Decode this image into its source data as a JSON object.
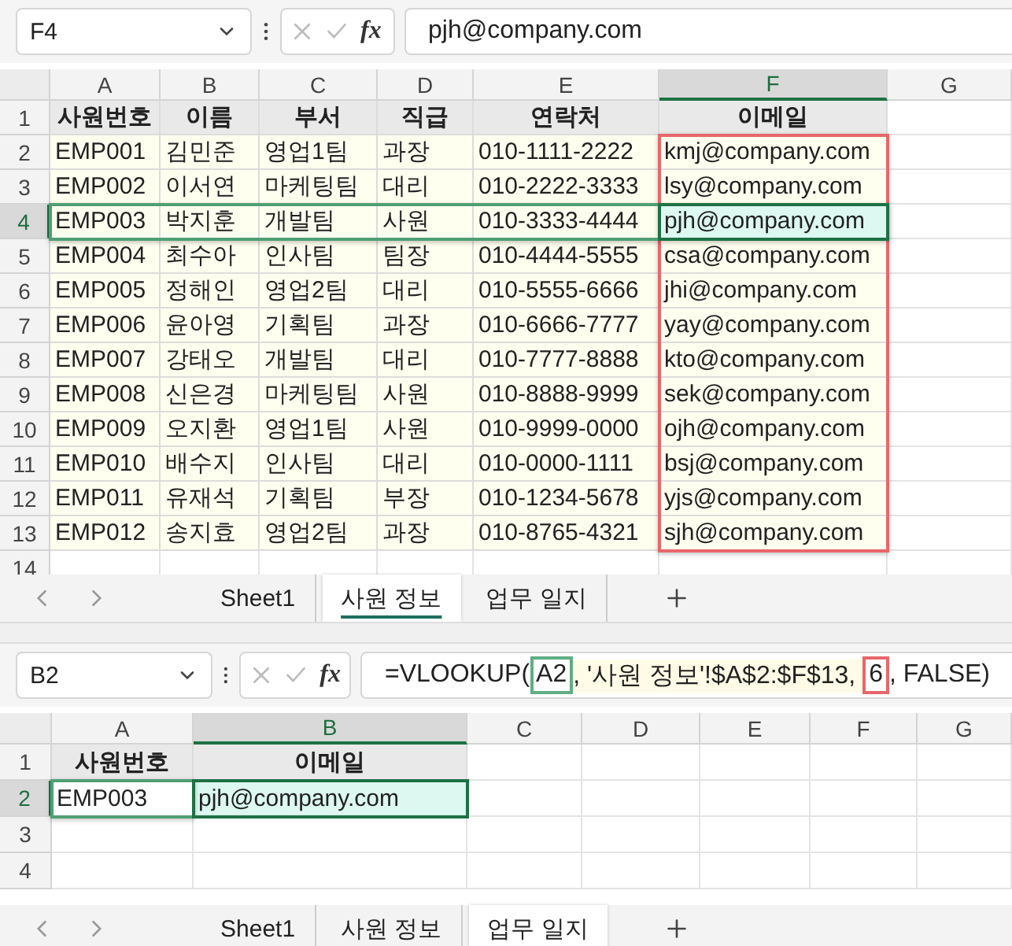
{
  "sheets": [
    {
      "formula_bar": {
        "name_box": "F4",
        "function_label": "fx",
        "parts": [
          {
            "text": "pjh@company.com",
            "kind": "plain"
          }
        ]
      },
      "columns": [
        {
          "label": "A",
          "selected": false
        },
        {
          "label": "B",
          "selected": false
        },
        {
          "label": "C",
          "selected": false
        },
        {
          "label": "D",
          "selected": false
        },
        {
          "label": "E",
          "selected": false
        },
        {
          "label": "F",
          "selected": true,
          "result_outline": true
        },
        {
          "label": "G",
          "selected": false
        }
      ],
      "rows": [
        {
          "number": "1",
          "selected": false,
          "kind": "header",
          "cells": [
            "사원번호",
            "이름",
            "부서",
            "직급",
            "연락처",
            "이메일"
          ]
        },
        {
          "number": "2",
          "selected": false,
          "kind": "data",
          "cells": [
            "EMP001",
            "김민준",
            "영업1팀",
            "과장",
            "010-1111-2222",
            "kmj@company.com"
          ]
        },
        {
          "number": "3",
          "selected": false,
          "kind": "data",
          "cells": [
            "EMP002",
            "이서연",
            "마케팅팀",
            "대리",
            "010-2222-3333",
            "lsy@company.com"
          ]
        },
        {
          "number": "4",
          "selected": true,
          "ref_outline": true,
          "kind": "data",
          "cells": [
            "EMP003",
            "박지훈",
            "개발팀",
            "사원",
            "010-3333-4444",
            "pjh@company.com"
          ]
        },
        {
          "number": "5",
          "selected": false,
          "kind": "data",
          "cells": [
            "EMP004",
            "최수아",
            "인사팀",
            "팀장",
            "010-4444-5555",
            "csa@company.com"
          ]
        },
        {
          "number": "6",
          "selected": false,
          "kind": "data",
          "cells": [
            "EMP005",
            "정해인",
            "영업2팀",
            "대리",
            "010-5555-6666",
            "jhi@company.com"
          ]
        },
        {
          "number": "7",
          "selected": false,
          "kind": "data",
          "cells": [
            "EMP006",
            "윤아영",
            "기획팀",
            "과장",
            "010-6666-7777",
            "yay@company.com"
          ]
        },
        {
          "number": "8",
          "selected": false,
          "kind": "data",
          "cells": [
            "EMP007",
            "강태오",
            "개발팀",
            "대리",
            "010-7777-8888",
            "kto@company.com"
          ]
        },
        {
          "number": "9",
          "selected": false,
          "kind": "data",
          "cells": [
            "EMP008",
            "신은경",
            "마케팅팀",
            "사원",
            "010-8888-9999",
            "sek@company.com"
          ]
        },
        {
          "number": "10",
          "selected": false,
          "kind": "data",
          "cells": [
            "EMP009",
            "오지환",
            "영업1팀",
            "사원",
            "010-9999-0000",
            "ojh@company.com"
          ]
        },
        {
          "number": "11",
          "selected": false,
          "kind": "data",
          "cells": [
            "EMP010",
            "배수지",
            "인사팀",
            "대리",
            "010-0000-1111",
            "bsj@company.com"
          ]
        },
        {
          "number": "12",
          "selected": false,
          "kind": "data",
          "cells": [
            "EMP011",
            "유재석",
            "기획팀",
            "부장",
            "010-1234-5678",
            "yjs@company.com"
          ]
        },
        {
          "number": "13",
          "selected": false,
          "kind": "data",
          "cells": [
            "EMP012",
            "송지효",
            "영업2팀",
            "과장",
            "010-8765-4321",
            "sjh@company.com"
          ]
        },
        {
          "number": "14",
          "selected": false,
          "cells": []
        }
      ],
      "tabs": [
        {
          "label": "Sheet1",
          "selected": false
        },
        {
          "label": "사원 정보",
          "selected": true
        },
        {
          "label": "업무 일지",
          "selected": false
        }
      ]
    },
    {
      "formula_bar": {
        "name_box": "B2",
        "function_label": "fx",
        "parts": [
          {
            "text": "=VLOOKUP(",
            "kind": "plain"
          },
          {
            "text": "A2",
            "kind": "reference"
          },
          {
            "text": ", '사원 정보'!$A$2:$F$13, ",
            "kind": "hint"
          },
          {
            "text": "6",
            "kind": "result"
          },
          {
            "text": ", FALSE)",
            "kind": "plain"
          }
        ]
      },
      "columns": [
        {
          "label": "A",
          "selected": false,
          "ref_outline": true
        },
        {
          "label": "B",
          "selected": true
        },
        {
          "label": "C",
          "selected": false
        },
        {
          "label": "D",
          "selected": false
        },
        {
          "label": "E",
          "selected": false
        },
        {
          "label": "F",
          "selected": false
        },
        {
          "label": "G",
          "selected": false
        }
      ],
      "rows": [
        {
          "number": "1",
          "selected": false,
          "kind": "header",
          "cells": [
            "사원번호",
            "이메일"
          ]
        },
        {
          "number": "2",
          "selected": true,
          "kind": "plain",
          "cells": [
            "EMP003",
            "pjh@company.com"
          ]
        },
        {
          "number": "3",
          "selected": false,
          "cells": []
        },
        {
          "number": "4",
          "selected": false,
          "cells": []
        }
      ],
      "tabs": [
        {
          "label": "Sheet1",
          "selected": false
        },
        {
          "label": "사원 정보",
          "selected": false
        },
        {
          "label": "업무 일지",
          "selected": true
        }
      ]
    }
  ]
}
